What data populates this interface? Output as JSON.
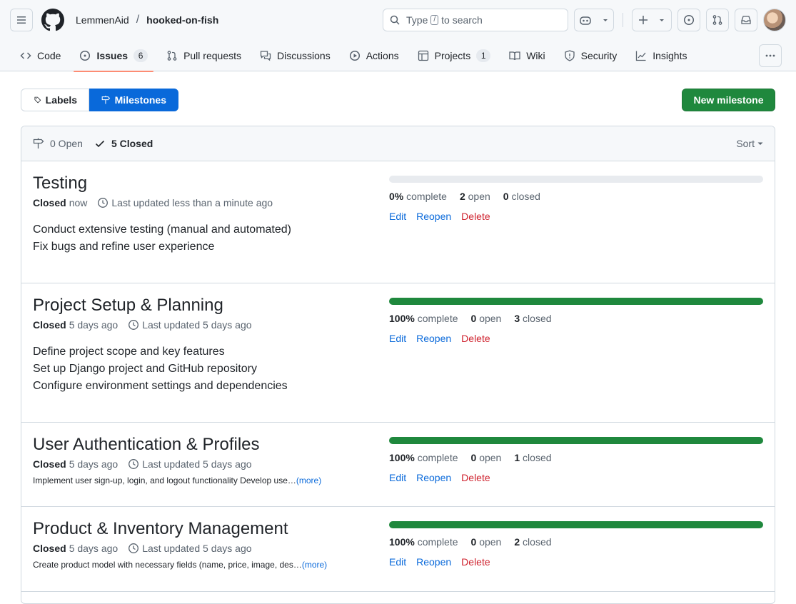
{
  "header": {
    "owner": "LemmenAid",
    "separator": "/",
    "repo": "hooked-on-fish",
    "search": {
      "prefix": "Type",
      "key": "/",
      "suffix": "to search"
    }
  },
  "tabs": [
    {
      "label": "Code",
      "icon": "code-icon"
    },
    {
      "label": "Issues",
      "icon": "issue-icon",
      "count": "6"
    },
    {
      "label": "Pull requests",
      "icon": "pull-request-icon"
    },
    {
      "label": "Discussions",
      "icon": "discussion-icon"
    },
    {
      "label": "Actions",
      "icon": "play-icon"
    },
    {
      "label": "Projects",
      "icon": "table-icon",
      "count": "1"
    },
    {
      "label": "Wiki",
      "icon": "book-icon"
    },
    {
      "label": "Security",
      "icon": "shield-icon"
    },
    {
      "label": "Insights",
      "icon": "graph-icon"
    }
  ],
  "subnav": {
    "labels": "Labels",
    "milestones": "Milestones",
    "new_milestone": "New milestone"
  },
  "filter": {
    "open": "0 Open",
    "closed": "5 Closed",
    "sort": "Sort"
  },
  "milestones": [
    {
      "title": "Testing",
      "status": "Closed",
      "closed_when": "now",
      "updated": "Last updated less than a minute ago",
      "desc": [
        "Conduct extensive testing (manual and automated)",
        "Fix bugs and refine user experience"
      ],
      "percent_value": 0,
      "percent": "0%",
      "complete": "complete",
      "open_count": "2",
      "open_label": "open",
      "closed_count": "0",
      "closed_label": "closed"
    },
    {
      "title": "Project Setup & Planning",
      "status": "Closed",
      "closed_when": "5 days ago",
      "updated": "Last updated 5 days ago",
      "desc": [
        "Define project scope and key features",
        "Set up Django project and GitHub repository",
        "Configure environment settings and dependencies"
      ],
      "percent_value": 100,
      "percent": "100%",
      "complete": "complete",
      "open_count": "0",
      "open_label": "open",
      "closed_count": "3",
      "closed_label": "closed"
    },
    {
      "title": "User Authentication & Profiles",
      "status": "Closed",
      "closed_when": "5 days ago",
      "updated": "Last updated 5 days ago",
      "short_desc": "Implement user sign-up, login, and logout functionality Develop use…",
      "more": "(more)",
      "percent_value": 100,
      "percent": "100%",
      "complete": "complete",
      "open_count": "0",
      "open_label": "open",
      "closed_count": "1",
      "closed_label": "closed"
    },
    {
      "title": "Product & Inventory Management",
      "status": "Closed",
      "closed_when": "5 days ago",
      "updated": "Last updated 5 days ago",
      "short_desc": "Create product model with necessary fields (name, price, image, des…",
      "more": "(more)",
      "percent_value": 100,
      "percent": "100%",
      "complete": "complete",
      "open_count": "0",
      "open_label": "open",
      "closed_count": "2",
      "closed_label": "closed"
    }
  ],
  "actions": {
    "edit": "Edit",
    "reopen": "Reopen",
    "delete": "Delete"
  },
  "colors": {
    "accent": "#0969da",
    "success": "#1f883d",
    "danger": "#cf222e",
    "tab_underline": "#fd8c73"
  }
}
